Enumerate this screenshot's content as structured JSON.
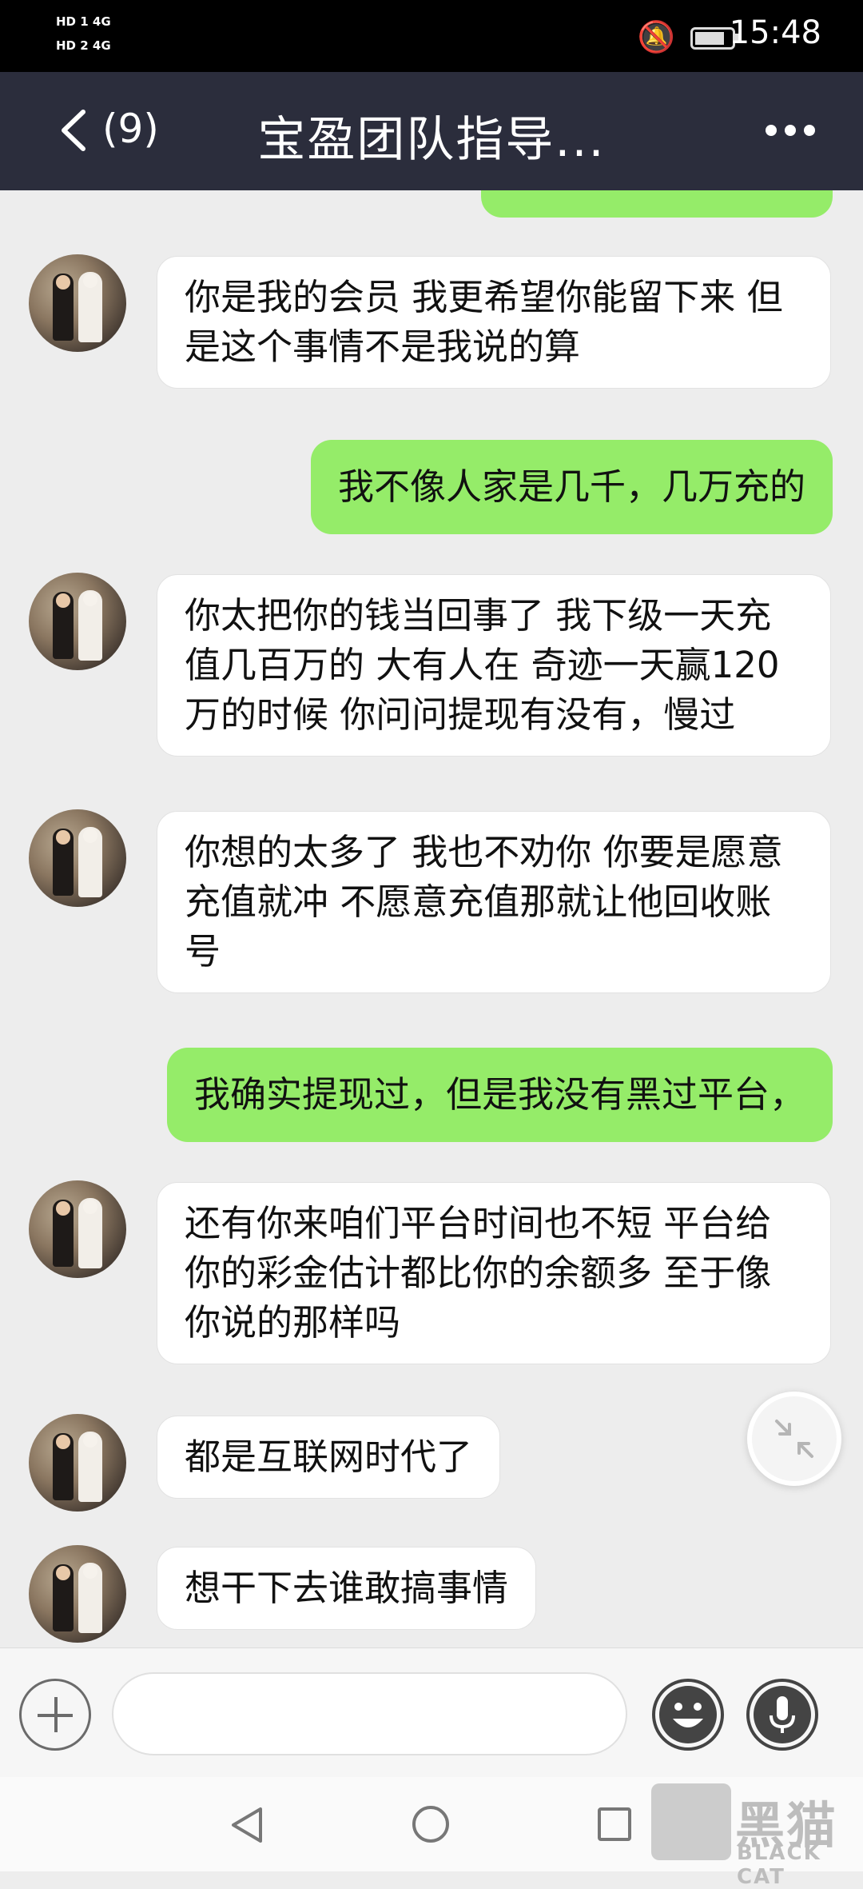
{
  "status_bar": {
    "sim1": "HD 1 4G",
    "sim2": "HD 2 4G",
    "time": "15:48"
  },
  "header": {
    "back_count": "(9)",
    "title": "宝盈团队指导..."
  },
  "messages": [
    {
      "side": "in",
      "text": "你是我的会员 我更希望你能留下来 但是这个事情不是我说的算"
    },
    {
      "side": "out",
      "text": "我不像人家是几千，几万充的"
    },
    {
      "side": "in",
      "text": "你太把你的钱当回事了 我下级一天充值几百万的 大有人在 奇迹一天赢120万的时候 你问问提现有没有，慢过"
    },
    {
      "side": "in",
      "text": "你想的太多了 我也不劝你 你要是愿意充值就冲 不愿意充值那就让他回收账号"
    },
    {
      "side": "out",
      "text": "我确实提现过，但是我没有黑过平台，"
    },
    {
      "side": "in",
      "text": "还有你来咱们平台时间也不短 平台给你的彩金估计都比你的余额多 至于像你说的那样吗"
    },
    {
      "side": "in",
      "text": "都是互联网时代了"
    },
    {
      "side": "in",
      "text": "想干下去谁敢搞事情"
    }
  ],
  "input_bar": {
    "placeholder": ""
  },
  "watermark": {
    "cn": "黑猫",
    "en": "BLACK CAT"
  },
  "colors": {
    "header_bg": "#2b2d3c",
    "outgoing_bubble": "#95ec69",
    "incoming_bubble": "#ffffff",
    "chat_bg": "#ededed"
  }
}
